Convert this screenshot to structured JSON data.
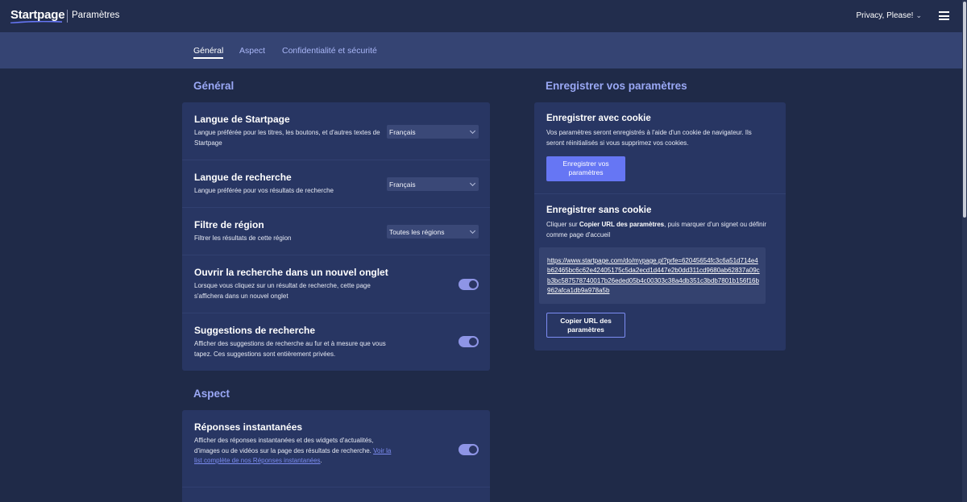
{
  "header": {
    "logo": "Startpage",
    "page_name": "Paramètres",
    "privacy_label": "Privacy, Please!",
    "privacy_chevron": "⌄"
  },
  "tabs": [
    {
      "label": "Général",
      "active": true
    },
    {
      "label": "Aspect",
      "active": false
    },
    {
      "label": "Confidentialité et sécurité",
      "active": false
    }
  ],
  "general": {
    "title": "Général",
    "rows": [
      {
        "title": "Langue de Startpage",
        "desc": "Langue préférée pour les titres, les boutons, et d'autres textes de Startpage",
        "control": "select",
        "value": "Français"
      },
      {
        "title": "Langue de recherche",
        "desc": "Langue préférée pour vos résultats de recherche",
        "control": "select",
        "value": "Français"
      },
      {
        "title": "Filtre de région",
        "desc": "Filtrer les résultats de cette région",
        "control": "select",
        "value": "Toutes les régions"
      },
      {
        "title": "Ouvrir la recherche dans un nouvel onglet",
        "desc": "Lorsque vous cliquez sur un résultat de recherche, cette page s'affichera dans un nouvel onglet",
        "control": "toggle",
        "on": true
      },
      {
        "title": "Suggestions de recherche",
        "desc": "Afficher des suggestions de recherche au fur et à mesure que vous tapez. Ces suggestions sont entièrement privées.",
        "control": "toggle",
        "on": true
      }
    ]
  },
  "aspect": {
    "title": "Aspect",
    "rows": [
      {
        "title": "Réponses instantanées",
        "desc": "Afficher des réponses instantanées et des widgets d'actualités, d'images ou de vidéos sur la page des résultats de recherche.",
        "link": "Voir la list complète de nos Réponses instantanées",
        "after_link": ".",
        "control": "toggle",
        "on": true
      }
    ]
  },
  "save": {
    "title": "Enregistrer vos paramètres",
    "with_cookie": {
      "title": "Enregistrer avec cookie",
      "desc": "Vos paramètres seront enregistrés à l'aide d'un cookie de navigateur. Ils seront réinitialisés si vous supprimez vos cookies.",
      "button": "Enregistrer vos paramètres"
    },
    "without_cookie": {
      "title": "Enregistrer sans cookie",
      "desc_prefix": "Cliquer sur ",
      "desc_bold": "Copier URL des paramètres",
      "desc_suffix": ", puis marquer d'un signet ou définir comme page d'accueil",
      "url": "https://www.startpage.com/do/mypage.pl?prfe=62045654fc3c6a51d714e4b62465bc6c62e42405175c5da2ecd1d447e2b0dd311cd9680ab62837a09cb3bc587578740017b26eded05b4c00303c38a4db351c3bdb7801b156f16b962afca1db9a978a5b",
      "button": "Copier URL des paramètres"
    }
  },
  "colors": {
    "background": "#1f2a48",
    "card": "#283663",
    "accent": "#6676f4",
    "section_title": "#9aa8f5"
  }
}
